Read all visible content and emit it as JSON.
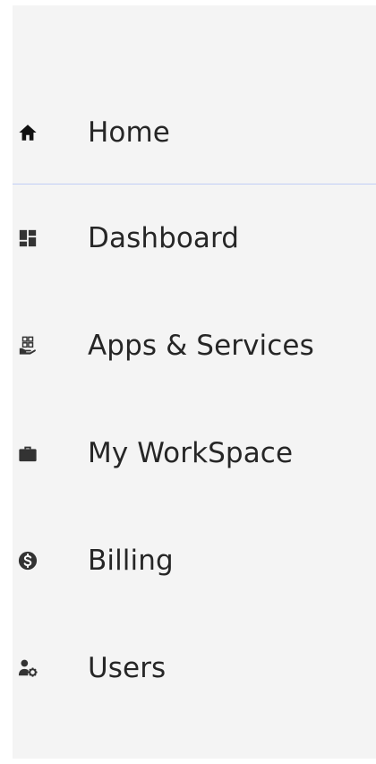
{
  "sidebar": {
    "items": [
      {
        "label": "Home",
        "icon": "home-icon",
        "active": true
      },
      {
        "label": "Dashboard",
        "icon": "dashboard-icon"
      },
      {
        "label": "Apps & Services",
        "icon": "apps-services-icon"
      },
      {
        "label": "My WorkSpace",
        "icon": "briefcase-icon"
      },
      {
        "label": "Billing",
        "icon": "dollar-circle-icon"
      },
      {
        "label": "Users",
        "icon": "user-settings-icon"
      }
    ]
  },
  "colors": {
    "sidebar_bg": "#f4f4f4",
    "text": "#262626",
    "icon": "#2e2e2e",
    "active_divider": "#c2cdf5"
  }
}
